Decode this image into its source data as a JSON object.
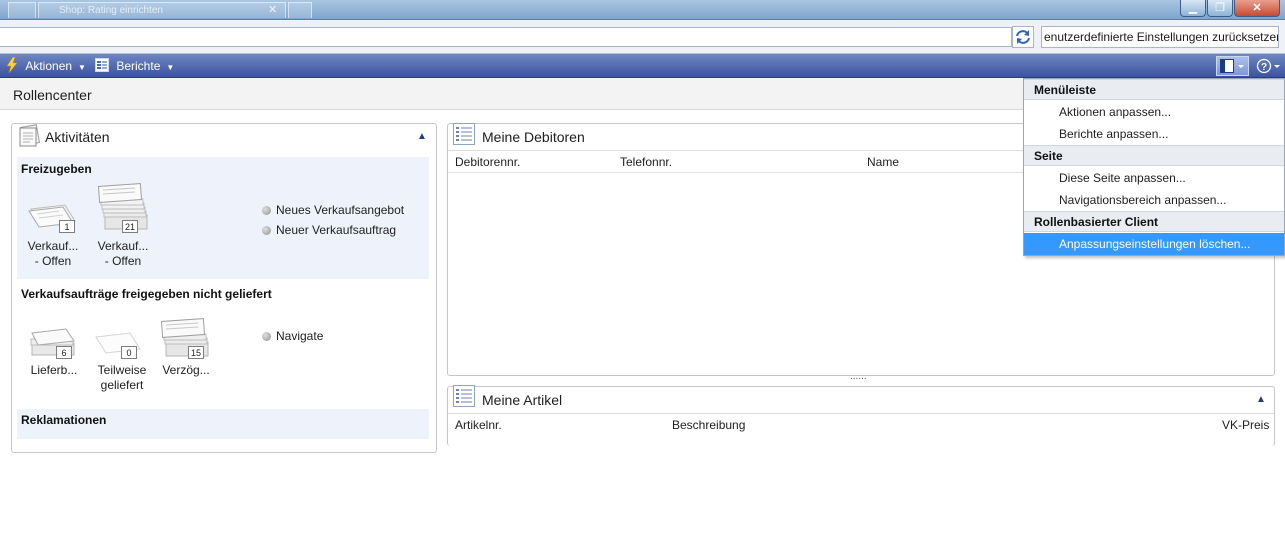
{
  "browser": {
    "tab_title": "Shop: Rating einrichten",
    "search_text": "enutzerdefinierte Einstellungen zurücksetzen"
  },
  "commandbar": {
    "actions_label": "Aktionen",
    "reports_label": "Berichte"
  },
  "page": {
    "title": "Rollencenter"
  },
  "activities": {
    "title": "Aktivitäten",
    "sections": [
      {
        "header": "Freizugeben",
        "tiles": [
          {
            "count": "1",
            "line1": "Verkauf...",
            "line2": "- Offen"
          },
          {
            "count": "21",
            "line1": "Verkauf...",
            "line2": "- Offen"
          }
        ],
        "links": [
          "Neues Verkaufsangebot",
          "Neuer Verkaufsauftrag"
        ]
      },
      {
        "header": "Verkaufsaufträge freigegeben nicht geliefert",
        "tiles": [
          {
            "count": "6",
            "line1": "Lieferb...",
            "line2": ""
          },
          {
            "count": "0",
            "line1": "Teilweise",
            "line2": "geliefert"
          },
          {
            "count": "15",
            "line1": "Verzög...",
            "line2": ""
          }
        ],
        "links": [
          "Navigate"
        ]
      },
      {
        "header": "Reklamationen"
      }
    ]
  },
  "customers": {
    "title": "Meine Debitoren",
    "columns": [
      "Debitorennr.",
      "Telefonnr.",
      "Name"
    ],
    "splitter": "......"
  },
  "items": {
    "title": "Meine Artikel",
    "columns": [
      "Artikelnr.",
      "Beschreibung",
      "VK-Preis"
    ]
  },
  "menu": {
    "groups": [
      {
        "header": "Menüleiste",
        "items": [
          "Aktionen anpassen...",
          "Berichte anpassen..."
        ]
      },
      {
        "header": "Seite",
        "items": [
          "Diese Seite anpassen...",
          "Navigationsbereich anpassen..."
        ]
      },
      {
        "header": "Rollenbasierter Client",
        "items": [
          "Anpassungseinstellungen löschen..."
        ]
      }
    ],
    "selected_item": "Anpassungseinstellungen löschen..."
  },
  "colors": {
    "command_bar": "#3c53a0",
    "menu_highlight": "#3399ff",
    "section_bg": "#eef3fb"
  }
}
